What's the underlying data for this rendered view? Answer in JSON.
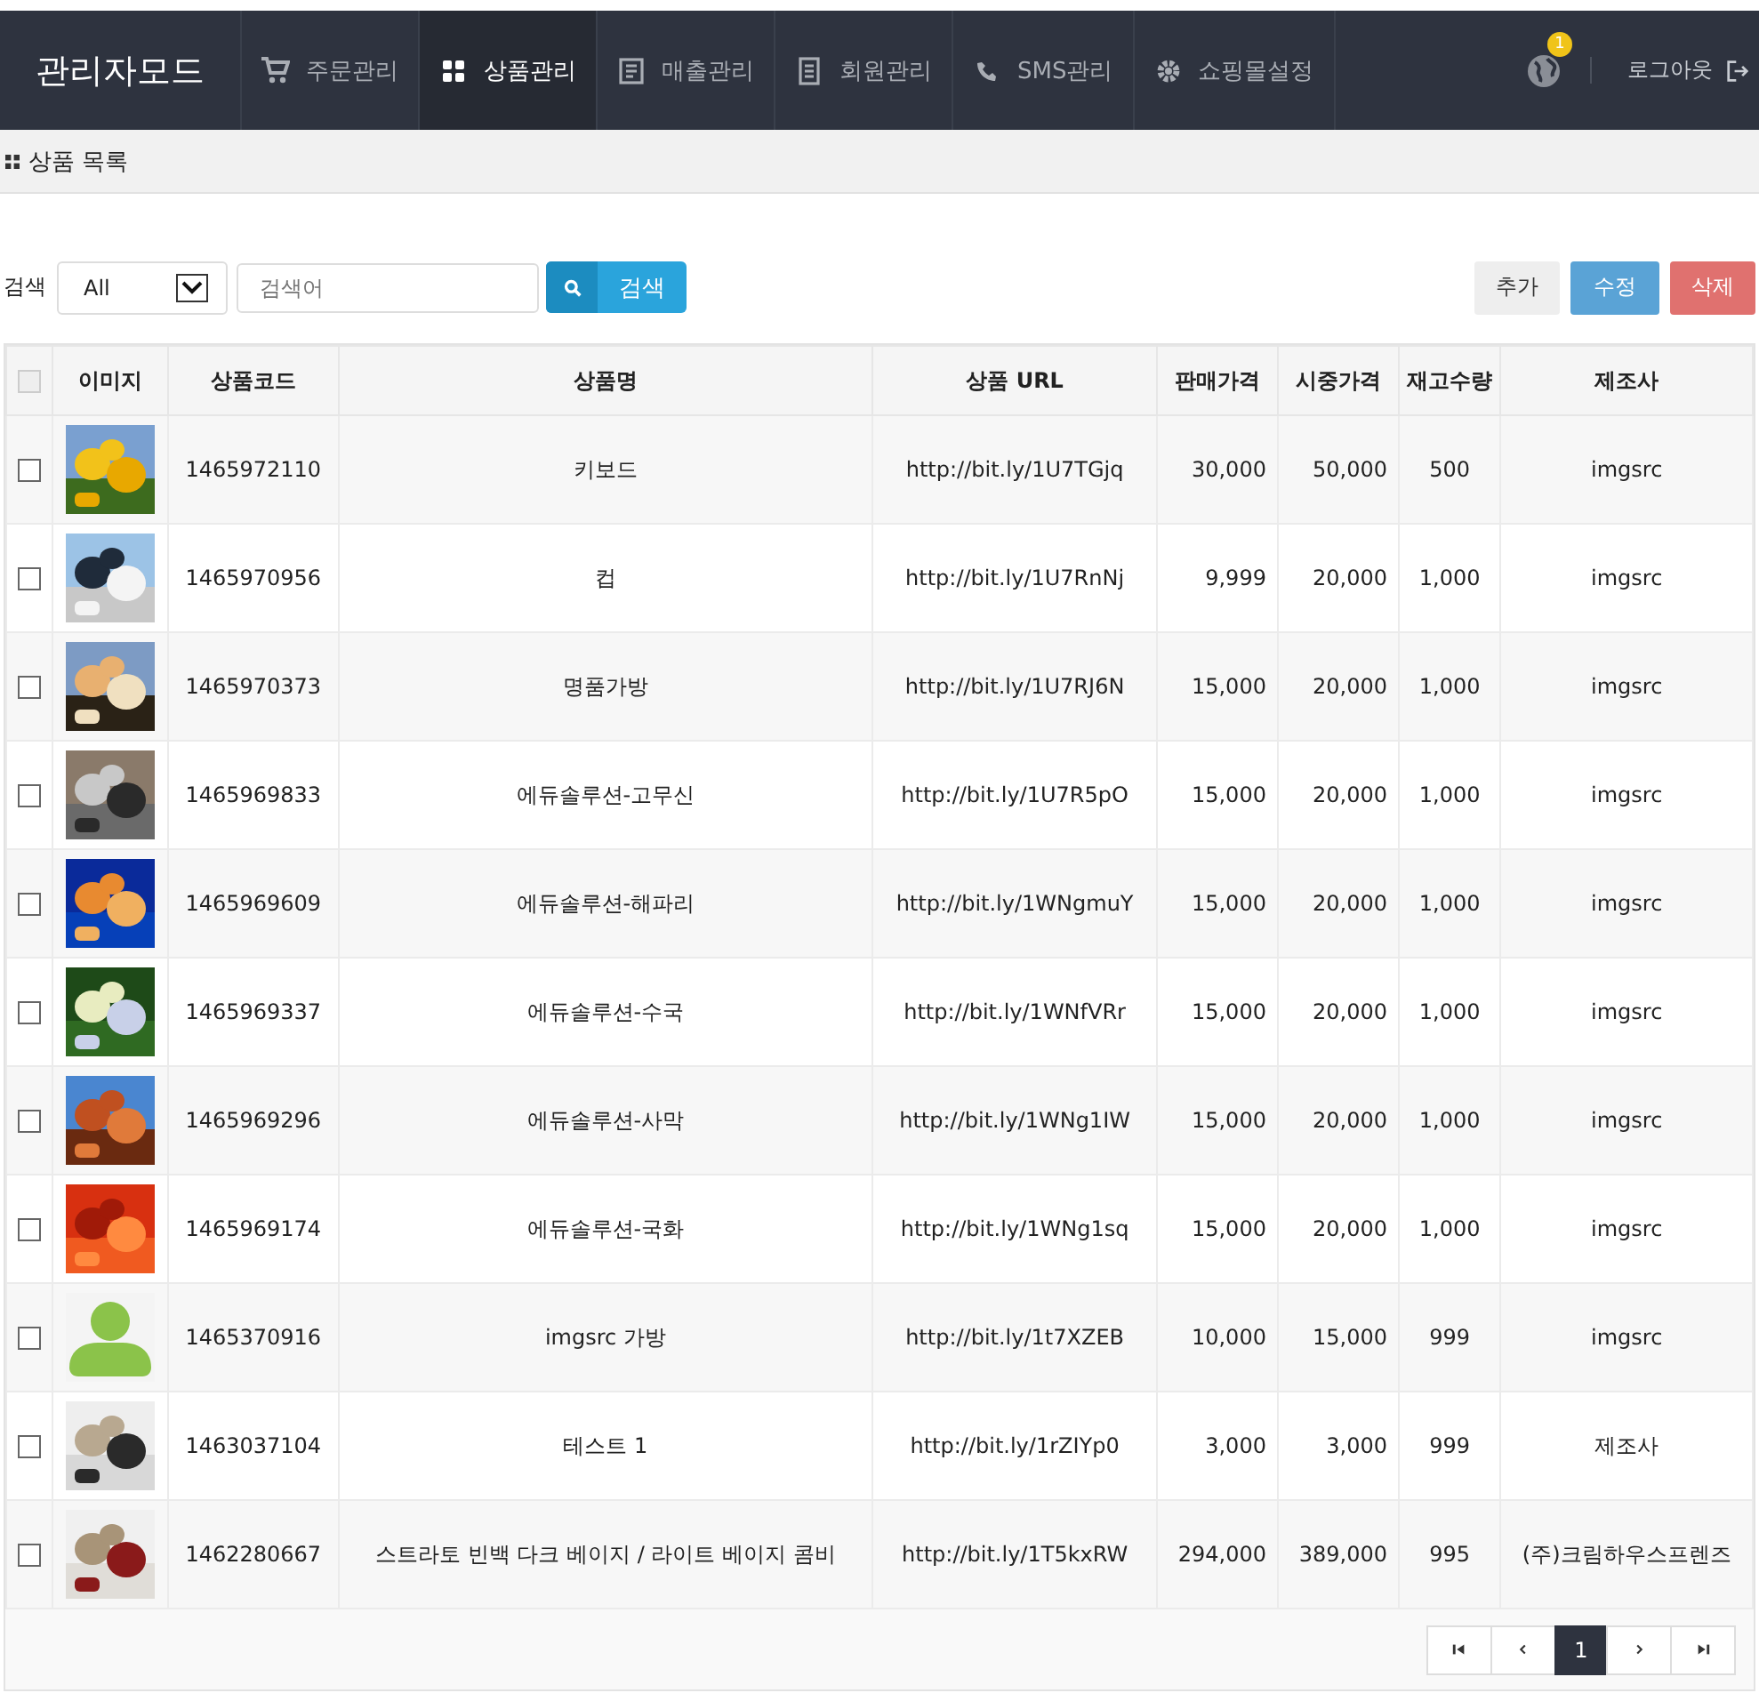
{
  "brand": "관리자모드",
  "nav": [
    {
      "label": "주문관리",
      "selected": false
    },
    {
      "label": "상품관리",
      "selected": true
    },
    {
      "label": "매출관리",
      "selected": false
    },
    {
      "label": "회원관리",
      "selected": false
    },
    {
      "label": "SMS관리",
      "selected": false
    },
    {
      "label": "쇼핑몰설정",
      "selected": false
    }
  ],
  "notification_badge": "1",
  "logout": "로그아웃",
  "breadcrumb": "상품 목록",
  "search": {
    "label": "검색",
    "select_value": "All",
    "placeholder": "검색어",
    "button": "검색"
  },
  "actions": [
    {
      "label": "추가",
      "kind": "default"
    },
    {
      "label": "수정",
      "kind": "info"
    },
    {
      "label": "삭제",
      "kind": "danger"
    }
  ],
  "table": {
    "select_all_checked": false,
    "columns": [
      "이미지",
      "상품코드",
      "상품명",
      "상품 URL",
      "판매가격",
      "시중가격",
      "재고수량",
      "제조사"
    ],
    "rows": [
      {
        "checked": false,
        "kind": "picture",
        "code": "1465972110",
        "name": "키보드",
        "url": "http://bit.ly/1U7TGjq",
        "price": "30,000",
        "market_price": "50,000",
        "stock": "500",
        "maker": "imgsrc"
      },
      {
        "checked": false,
        "kind": "picture",
        "code": "1465970956",
        "name": "컵",
        "url": "http://bit.ly/1U7RnNj",
        "price": "9,999",
        "market_price": "20,000",
        "stock": "1,000",
        "maker": "imgsrc"
      },
      {
        "checked": false,
        "kind": "picture",
        "code": "1465970373",
        "name": "명품가방",
        "url": "http://bit.ly/1U7RJ6N",
        "price": "15,000",
        "market_price": "20,000",
        "stock": "1,000",
        "maker": "imgsrc"
      },
      {
        "checked": false,
        "kind": "picture",
        "code": "1465969833",
        "name": "에듀솔루션-고무신",
        "url": "http://bit.ly/1U7R5pO",
        "price": "15,000",
        "market_price": "20,000",
        "stock": "1,000",
        "maker": "imgsrc"
      },
      {
        "checked": false,
        "kind": "picture",
        "code": "1465969609",
        "name": "에듀솔루션-해파리",
        "url": "http://bit.ly/1WNgmuY",
        "price": "15,000",
        "market_price": "20,000",
        "stock": "1,000",
        "maker": "imgsrc"
      },
      {
        "checked": false,
        "kind": "picture",
        "code": "1465969337",
        "name": "에듀솔루션-수국",
        "url": "http://bit.ly/1WNfVRr",
        "price": "15,000",
        "market_price": "20,000",
        "stock": "1,000",
        "maker": "imgsrc"
      },
      {
        "checked": false,
        "kind": "picture",
        "code": "1465969296",
        "name": "에듀솔루션-사막",
        "url": "http://bit.ly/1WNg1IW",
        "price": "15,000",
        "market_price": "20,000",
        "stock": "1,000",
        "maker": "imgsrc"
      },
      {
        "checked": false,
        "kind": "picture",
        "code": "1465969174",
        "name": "에듀솔루션-국화",
        "url": "http://bit.ly/1WNg1sq",
        "price": "15,000",
        "market_price": "20,000",
        "stock": "1,000",
        "maker": "imgsrc"
      },
      {
        "checked": false,
        "kind": "avatar",
        "code": "1465370916",
        "name": "imgsrc 가방",
        "url": "http://bit.ly/1t7XZEB",
        "price": "10,000",
        "market_price": "15,000",
        "stock": "999",
        "maker": "imgsrc"
      },
      {
        "checked": false,
        "kind": "picture",
        "code": "1463037104",
        "name": "테스트 1",
        "url": "http://bit.ly/1rZIYp0",
        "price": "3,000",
        "market_price": "3,000",
        "stock": "999",
        "maker": "제조사"
      },
      {
        "checked": false,
        "kind": "picture",
        "code": "1462280667",
        "name": "스트라토 빈백 다크 베이지 / 라이트 베이지 콤비",
        "url": "http://bit.ly/1T5kxRW",
        "price": "294,000",
        "market_price": "389,000",
        "stock": "995",
        "maker": "(주)크림하우스프렌즈"
      }
    ]
  },
  "pagination": [
    {
      "kind": "first"
    },
    {
      "kind": "prev"
    },
    {
      "kind": "page",
      "label": "1",
      "selected": true
    },
    {
      "kind": "next"
    },
    {
      "kind": "last"
    }
  ]
}
